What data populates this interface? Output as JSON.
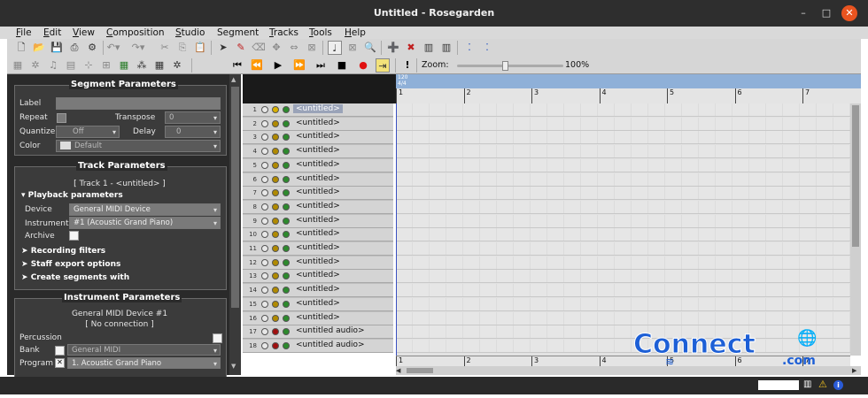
{
  "window": {
    "title": "Untitled - Rosegarden"
  },
  "menu": [
    {
      "label": "File",
      "u": "F",
      "rest": "ile"
    },
    {
      "label": "Edit",
      "u": "E",
      "rest": "dit"
    },
    {
      "label": "View",
      "u": "V",
      "rest": "iew"
    },
    {
      "label": "Composition",
      "u": "C",
      "rest": "omposition"
    },
    {
      "label": "Studio",
      "u": "S",
      "rest": "tudio"
    },
    {
      "label": "Segment",
      "u": "",
      "rest": "Segment"
    },
    {
      "label": "Tracks",
      "u": "T",
      "rest": "racks"
    },
    {
      "label": "Tools",
      "u": "T",
      "rest": "ools"
    },
    {
      "label": "Help",
      "u": "H",
      "rest": "elp"
    }
  ],
  "transport": {
    "zoom_label": "Zoom:",
    "zoom_value": "100%",
    "zoom_level": 0.45
  },
  "segment_params": {
    "title": "Segment Parameters",
    "label": "Label",
    "repeat": "Repeat",
    "transpose": "Transpose",
    "transpose_value": "0",
    "quantize": "Quantize",
    "quantize_value": "Off",
    "delay": "Delay",
    "delay_value": "0",
    "color": "Color",
    "color_value": "Default"
  },
  "track_params": {
    "title": "Track Parameters",
    "track_name": "[ Track 1 - <untitled> ]",
    "playback": "Playback parameters",
    "device": "Device",
    "device_value": "General MIDI Device",
    "instrument": "Instrument",
    "instrument_value": "#1 (Acoustic Grand Piano)",
    "archive": "Archive",
    "recording_filters": "Recording filters",
    "staff_export": "Staff export options",
    "create_segments": "Create segments with"
  },
  "instrument_params": {
    "title": "Instrument Parameters",
    "device_line": "General MIDI Device  #1",
    "connection": "[ No connection ]",
    "percussion": "Percussion",
    "bank": "Bank",
    "bank_value": "General MIDI",
    "program": "Program",
    "program_value": "1. Acoustic Grand Piano"
  },
  "tracks": [
    {
      "num": "1",
      "name": "<untitled>",
      "rec": "#d8b000"
    },
    {
      "num": "2",
      "name": "<untitled>",
      "rec": "#b08a00"
    },
    {
      "num": "3",
      "name": "<untitled>",
      "rec": "#b08a00"
    },
    {
      "num": "4",
      "name": "<untitled>",
      "rec": "#b08a00"
    },
    {
      "num": "5",
      "name": "<untitled>",
      "rec": "#b08a00"
    },
    {
      "num": "6",
      "name": "<untitled>",
      "rec": "#b08a00"
    },
    {
      "num": "7",
      "name": "<untitled>",
      "rec": "#b08a00"
    },
    {
      "num": "8",
      "name": "<untitled>",
      "rec": "#b08a00"
    },
    {
      "num": "9",
      "name": "<untitled>",
      "rec": "#b08a00"
    },
    {
      "num": "10",
      "name": "<untitled>",
      "rec": "#b08a00"
    },
    {
      "num": "11",
      "name": "<untitled>",
      "rec": "#b08a00"
    },
    {
      "num": "12",
      "name": "<untitled>",
      "rec": "#b08a00"
    },
    {
      "num": "13",
      "name": "<untitled>",
      "rec": "#b08a00"
    },
    {
      "num": "14",
      "name": "<untitled>",
      "rec": "#b08a00"
    },
    {
      "num": "15",
      "name": "<untitled>",
      "rec": "#b08a00"
    },
    {
      "num": "16",
      "name": "<untitled>",
      "rec": "#b08a00"
    },
    {
      "num": "17",
      "name": "<untitled audio>",
      "rec": "#a01010"
    },
    {
      "num": "18",
      "name": "<untitled audio>",
      "rec": "#a01010"
    }
  ],
  "ruler": {
    "tempo": "120",
    "timesig": "4/4",
    "bars": [
      "1",
      "2",
      "3",
      "4",
      "5",
      "6",
      "7"
    ]
  },
  "watermark": {
    "text": "Connect",
    "sub": ".com"
  },
  "colors": {
    "title_bg": "#2e2e2e",
    "panel_bg": "#2a2a2a",
    "close": "#e95420",
    "ruler_blue": "#8fb0d8",
    "mute_led": "#2d8a2d"
  }
}
